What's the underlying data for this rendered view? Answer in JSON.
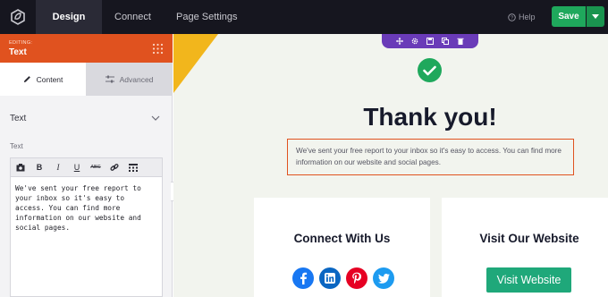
{
  "colors": {
    "topbar_bg": "#16161f",
    "accent_orange": "#e0521f",
    "save_green": "#1fa85c",
    "row_toolbar_purple": "#6a3bb8",
    "canvas_bg": "#f2f4ee",
    "accent_yellow": "#f2b61c"
  },
  "topbar": {
    "tabs": [
      {
        "label": "Design",
        "active": true
      },
      {
        "label": "Connect",
        "active": false
      },
      {
        "label": "Page Settings",
        "active": false
      }
    ],
    "help_label": "Help",
    "save_label": "Save",
    "icons": [
      "logo-icon",
      "help-icon",
      "caret-down-icon"
    ]
  },
  "sidebar": {
    "editing_label": "EDITING:",
    "editing_title": "Text",
    "tabs": [
      {
        "label": "Content",
        "icon": "pencil-icon",
        "active": true
      },
      {
        "label": "Advanced",
        "icon": "sliders-icon",
        "active": false
      }
    ],
    "section_title": "Text",
    "field_label": "Text",
    "editor_toolbar": [
      "media-icon",
      "bold-icon",
      "italic-icon",
      "underline-icon",
      "strikethrough-icon",
      "link-icon",
      "kitchen-sink-icon"
    ],
    "editor_toolbar_labels": {
      "bold": "B",
      "italic": "I",
      "underline": "U",
      "strike": "ABC"
    },
    "editor_text": "We've sent your free report to your inbox so it's easy to access. You can find more information on our website and social pages."
  },
  "canvas": {
    "row_toolbar_icons": [
      "move-icon",
      "settings-icon",
      "save-icon",
      "duplicate-icon",
      "delete-icon"
    ],
    "headline": "Thank you!",
    "body_text": "We've sent your free report to your inbox so it's easy to access. You can find more information on our website and social pages.",
    "cards": [
      {
        "title": "Connect With Us",
        "social_icons": [
          "facebook-icon",
          "linkedin-icon",
          "pinterest-icon",
          "twitter-icon"
        ]
      },
      {
        "title": "Visit Our Website",
        "button_label": "Visit Website"
      }
    ],
    "social_colors": {
      "facebook": "#1877f2",
      "linkedin": "#0a66c2",
      "pinterest": "#e60023",
      "twitter": "#1d9bf0"
    }
  }
}
